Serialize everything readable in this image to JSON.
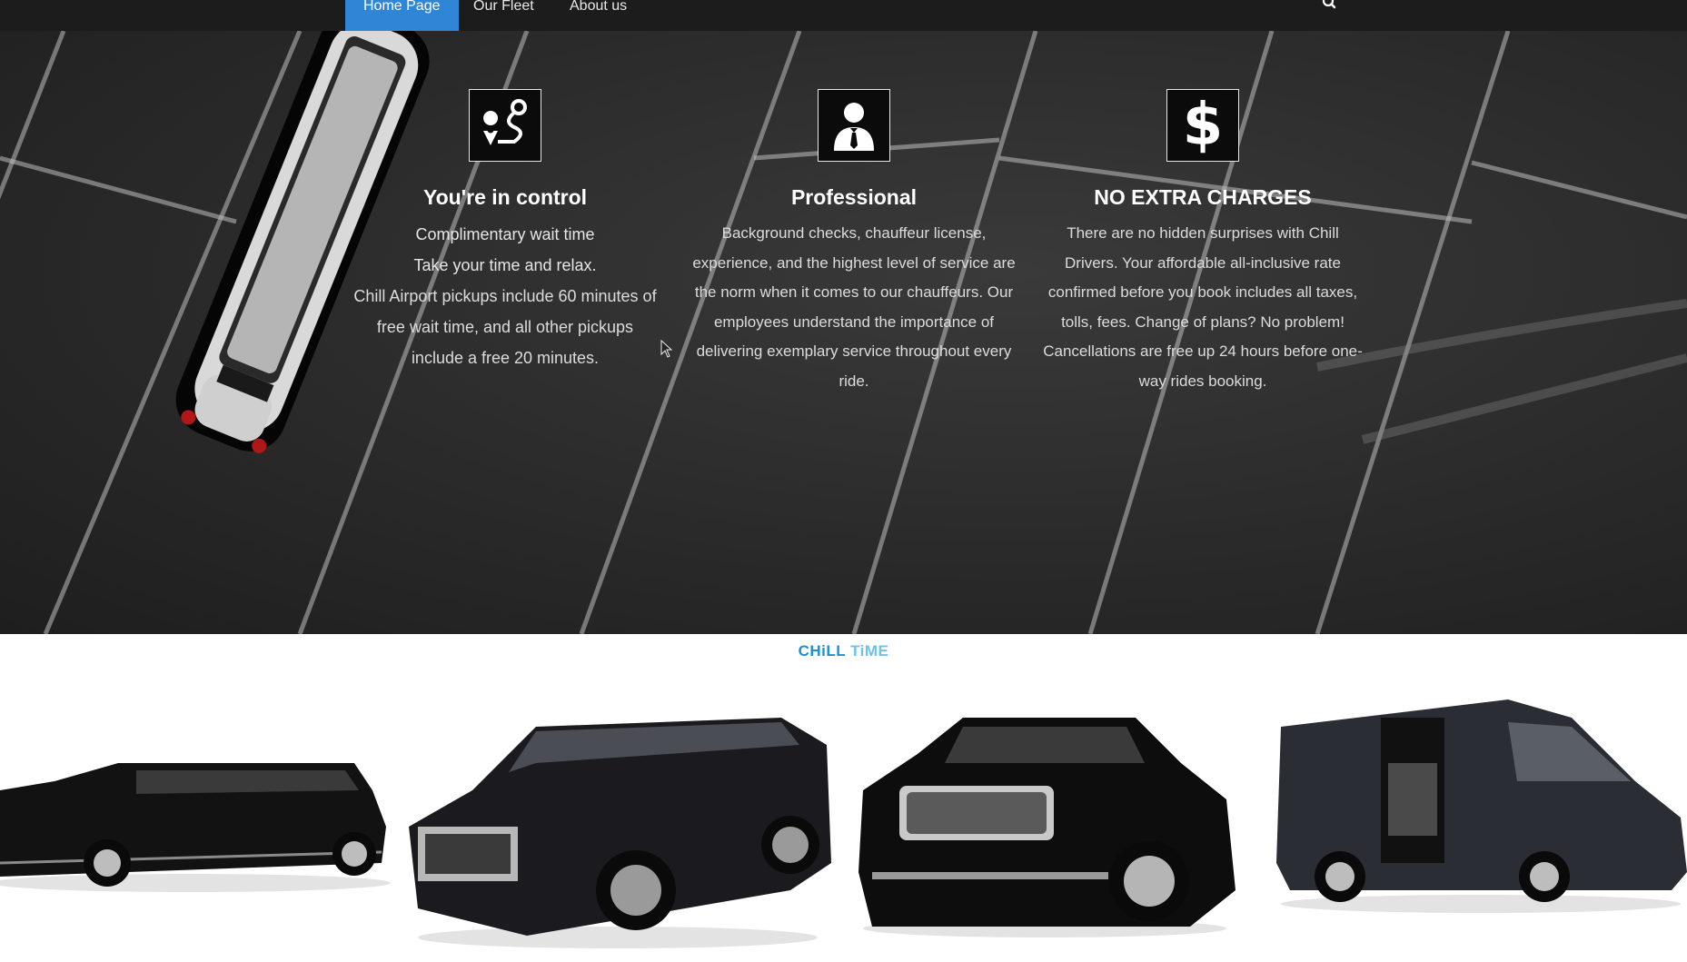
{
  "nav": {
    "items": [
      {
        "label": "Home Page",
        "active": true
      },
      {
        "label": "Our Fleet",
        "active": false
      },
      {
        "label": "About us",
        "active": false
      }
    ],
    "search_icon": "search-icon"
  },
  "hero": {
    "features": [
      {
        "icon": "route-pin-icon",
        "title": "You're in control",
        "lines": [
          "Complimentary wait time",
          "Take your time and relax."
        ],
        "text": "Chill Airport pickups include 60 minutes of free wait time, and all other pickups include a free 20 minutes."
      },
      {
        "icon": "chauffeur-icon",
        "title": "Professional",
        "text": "Background checks, chauffeur license, experience, and the highest level of service are the norm when it comes to our chauffeurs. Our employees understand the importance of delivering exemplary service throughout every ride."
      },
      {
        "icon": "dollar-icon",
        "title": "NO EXTRA CHARGES",
        "text": "There are no hidden surprises with Chill Drivers. Your affordable all-inclusive rate confirmed before you book includes all taxes, tolls, fees. Change of plans? No problem! Cancellations are free up 24 hours before one-way rides booking."
      }
    ]
  },
  "brand": {
    "part1": "CHiLL",
    "part2": "TiME",
    "color1": "#1e8fd0",
    "color2": "#6cc2ea"
  },
  "fleet": [
    "stretch-limousine",
    "cadillac-escalade-esv",
    "lincoln-navigator",
    "mercedes-sprinter-van"
  ],
  "colors": {
    "nav_bg": "#1c1c1c",
    "nav_active": "#2f86d6",
    "hero_bg": "#2b2b2b"
  }
}
